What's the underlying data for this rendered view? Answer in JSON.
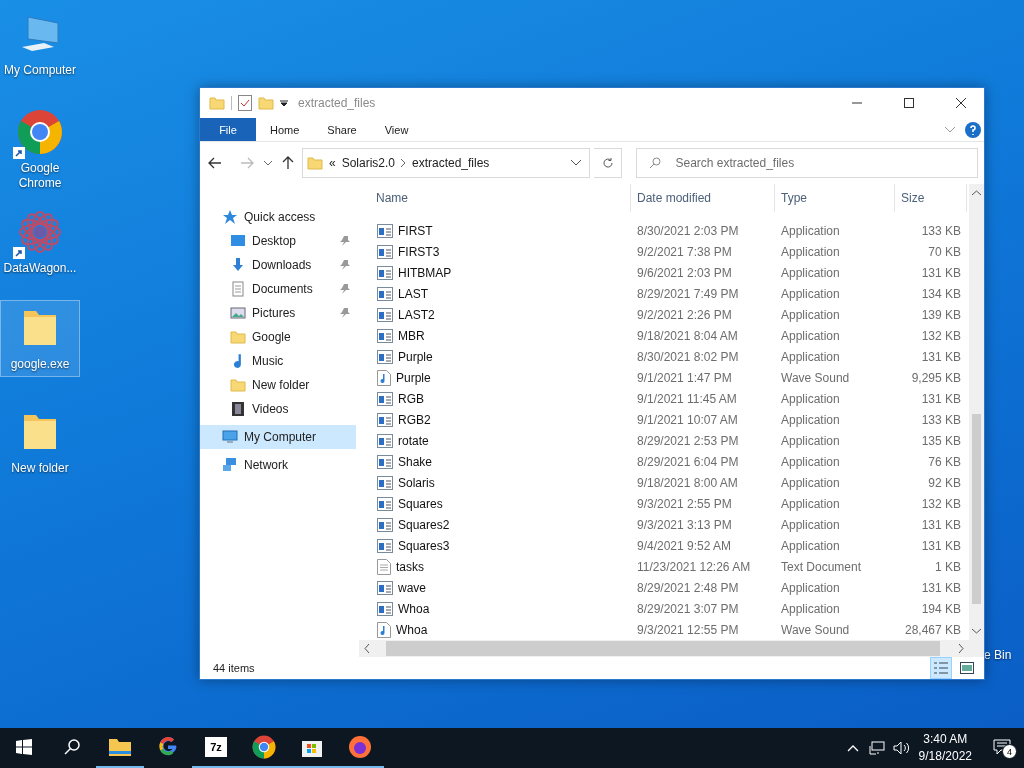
{
  "desktop_icons": [
    {
      "label": "My Computer",
      "kind": "computer",
      "shortcut": false,
      "selected": false
    },
    {
      "label": "Google Chrome",
      "kind": "chrome",
      "shortcut": true,
      "selected": false
    },
    {
      "label": "DataWagon...",
      "kind": "mandala",
      "shortcut": true,
      "selected": false
    },
    {
      "label": "google.exe",
      "kind": "folder",
      "shortcut": false,
      "selected": true
    },
    {
      "label": "New folder",
      "kind": "folder",
      "shortcut": false,
      "selected": false
    },
    {
      "label": "e Bin",
      "kind": "bin",
      "shortcut": false,
      "selected": false
    }
  ],
  "window": {
    "title": "extracted_files",
    "ribbon": {
      "file_tab": "File",
      "tabs": [
        "Home",
        "Share",
        "View"
      ]
    },
    "address": {
      "overflow": "«",
      "crumbs": [
        "Solaris2.0",
        "extracted_files"
      ]
    },
    "search": {
      "placeholder": "Search extracted_files"
    },
    "sidebar": {
      "items": [
        {
          "label": "Quick access",
          "kind": "star",
          "pinned": false,
          "selected": false,
          "top": true
        },
        {
          "label": "Desktop",
          "kind": "desktop",
          "pinned": true,
          "selected": false,
          "top": false
        },
        {
          "label": "Downloads",
          "kind": "download",
          "pinned": true,
          "selected": false,
          "top": false
        },
        {
          "label": "Documents",
          "kind": "document",
          "pinned": true,
          "selected": false,
          "top": false
        },
        {
          "label": "Pictures",
          "kind": "picture",
          "pinned": true,
          "selected": false,
          "top": false
        },
        {
          "label": "Google",
          "kind": "folder",
          "pinned": false,
          "selected": false,
          "top": false
        },
        {
          "label": "Music",
          "kind": "music",
          "pinned": false,
          "selected": false,
          "top": false
        },
        {
          "label": "New folder",
          "kind": "folder",
          "pinned": false,
          "selected": false,
          "top": false
        },
        {
          "label": "Videos",
          "kind": "video",
          "pinned": false,
          "selected": false,
          "top": false
        },
        {
          "label": "My Computer",
          "kind": "computer",
          "pinned": false,
          "selected": true,
          "top": true
        },
        {
          "label": "Network",
          "kind": "network",
          "pinned": false,
          "selected": false,
          "top": true
        }
      ]
    },
    "table": {
      "columns": [
        "Name",
        "Date modified",
        "Type",
        "Size"
      ],
      "rows": [
        {
          "name": "FIRST",
          "date": "8/30/2021 2:03 PM",
          "type": "Application",
          "size": "133 KB",
          "kind": "app"
        },
        {
          "name": "FIRST3",
          "date": "9/2/2021 7:38 PM",
          "type": "Application",
          "size": "70 KB",
          "kind": "app"
        },
        {
          "name": "HITBMAP",
          "date": "9/6/2021 2:03 PM",
          "type": "Application",
          "size": "131 KB",
          "kind": "app"
        },
        {
          "name": "LAST",
          "date": "8/29/2021 7:49 PM",
          "type": "Application",
          "size": "134 KB",
          "kind": "app"
        },
        {
          "name": "LAST2",
          "date": "9/2/2021 2:26 PM",
          "type": "Application",
          "size": "139 KB",
          "kind": "app"
        },
        {
          "name": "MBR",
          "date": "9/18/2021 8:04 AM",
          "type": "Application",
          "size": "132 KB",
          "kind": "app"
        },
        {
          "name": "Purple",
          "date": "8/30/2021 8:02 PM",
          "type": "Application",
          "size": "131 KB",
          "kind": "app"
        },
        {
          "name": "Purple",
          "date": "9/1/2021 1:47 PM",
          "type": "Wave Sound",
          "size": "9,295 KB",
          "kind": "wave"
        },
        {
          "name": "RGB",
          "date": "9/1/2021 11:45 AM",
          "type": "Application",
          "size": "131 KB",
          "kind": "app"
        },
        {
          "name": "RGB2",
          "date": "9/1/2021 10:07 AM",
          "type": "Application",
          "size": "133 KB",
          "kind": "app"
        },
        {
          "name": "rotate",
          "date": "8/29/2021 2:53 PM",
          "type": "Application",
          "size": "135 KB",
          "kind": "app"
        },
        {
          "name": "Shake",
          "date": "8/29/2021 6:04 PM",
          "type": "Application",
          "size": "76 KB",
          "kind": "app"
        },
        {
          "name": "Solaris",
          "date": "9/18/2021 8:00 AM",
          "type": "Application",
          "size": "92 KB",
          "kind": "app"
        },
        {
          "name": "Squares",
          "date": "9/3/2021 2:55 PM",
          "type": "Application",
          "size": "132 KB",
          "kind": "app"
        },
        {
          "name": "Squares2",
          "date": "9/3/2021 3:13 PM",
          "type": "Application",
          "size": "131 KB",
          "kind": "app"
        },
        {
          "name": "Squares3",
          "date": "9/4/2021 9:52 AM",
          "type": "Application",
          "size": "131 KB",
          "kind": "app"
        },
        {
          "name": "tasks",
          "date": "11/23/2021 12:26 AM",
          "type": "Text Document",
          "size": "1 KB",
          "kind": "text"
        },
        {
          "name": "wave",
          "date": "8/29/2021 2:48 PM",
          "type": "Application",
          "size": "131 KB",
          "kind": "app"
        },
        {
          "name": "Whoa",
          "date": "8/29/2021 3:07 PM",
          "type": "Application",
          "size": "194 KB",
          "kind": "app"
        },
        {
          "name": "Whoa",
          "date": "9/3/2021 12:55 PM",
          "type": "Wave Sound",
          "size": "28,467 KB",
          "kind": "wave"
        }
      ]
    },
    "status": "44 items",
    "views": [
      {
        "kind": "details",
        "selected": true
      },
      {
        "kind": "tiles",
        "selected": false
      }
    ]
  },
  "taskbar": {
    "apps": [
      {
        "kind": "explorer",
        "running": true
      },
      {
        "kind": "google",
        "running": false
      },
      {
        "kind": "sevenzip",
        "label": "7z",
        "running": true
      },
      {
        "kind": "chrome",
        "running": true
      },
      {
        "kind": "store",
        "running": true
      },
      {
        "kind": "firefox",
        "running": true
      }
    ],
    "time": "3:40 AM",
    "date": "9/18/2022",
    "notifications": "4"
  }
}
